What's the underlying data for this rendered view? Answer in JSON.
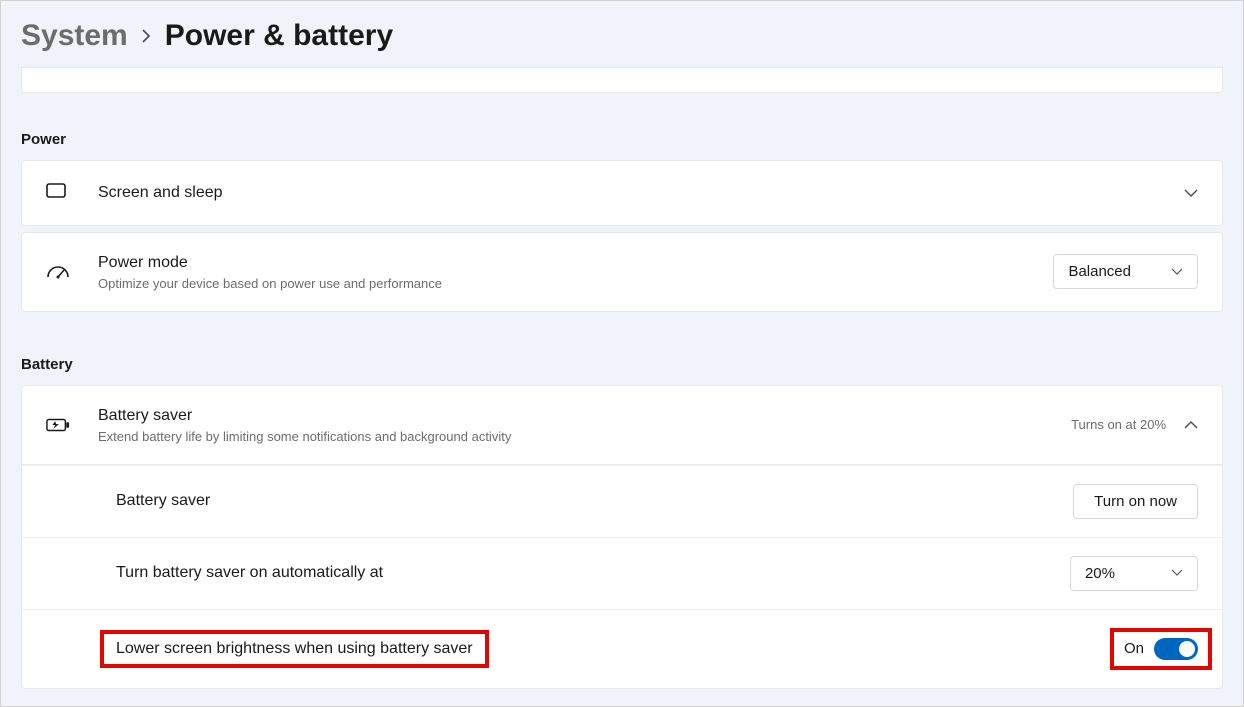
{
  "breadcrumb": {
    "parent": "System",
    "current": "Power & battery"
  },
  "sections": {
    "power": {
      "header": "Power",
      "screen_sleep": {
        "title": "Screen and sleep"
      },
      "power_mode": {
        "title": "Power mode",
        "subtitle": "Optimize your device based on power use and performance",
        "value": "Balanced"
      }
    },
    "battery": {
      "header": "Battery",
      "battery_saver": {
        "title": "Battery saver",
        "subtitle": "Extend battery life by limiting some notifications and background activity",
        "status": "Turns on at 20%"
      },
      "sub_rows": {
        "battery_saver_toggle": {
          "label": "Battery saver",
          "button": "Turn on now"
        },
        "auto_on": {
          "label": "Turn battery saver on automatically at",
          "value": "20%"
        },
        "brightness": {
          "label": "Lower screen brightness when using battery saver",
          "state": "On"
        }
      }
    }
  }
}
